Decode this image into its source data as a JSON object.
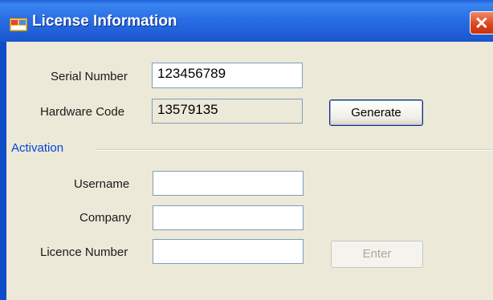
{
  "window": {
    "title": "License Information",
    "close_glyph": "✕",
    "icon_name": "app-window-icon"
  },
  "form": {
    "serial_number": {
      "label": "Serial Number",
      "value": "123456789"
    },
    "hardware_code": {
      "label": "Hardware Code",
      "value": "13579135"
    },
    "generate_button": "Generate",
    "activation_group": "Activation",
    "username": {
      "label": "Username",
      "value": ""
    },
    "company": {
      "label": "Company",
      "value": ""
    },
    "licence_number": {
      "label": "Licence Number",
      "value": ""
    },
    "enter_button": "Enter"
  },
  "colors": {
    "titlebar": "#2a6ee6",
    "window_bg": "#ece9d8",
    "group_label": "#0046d5",
    "close_button": "#d9431c"
  }
}
